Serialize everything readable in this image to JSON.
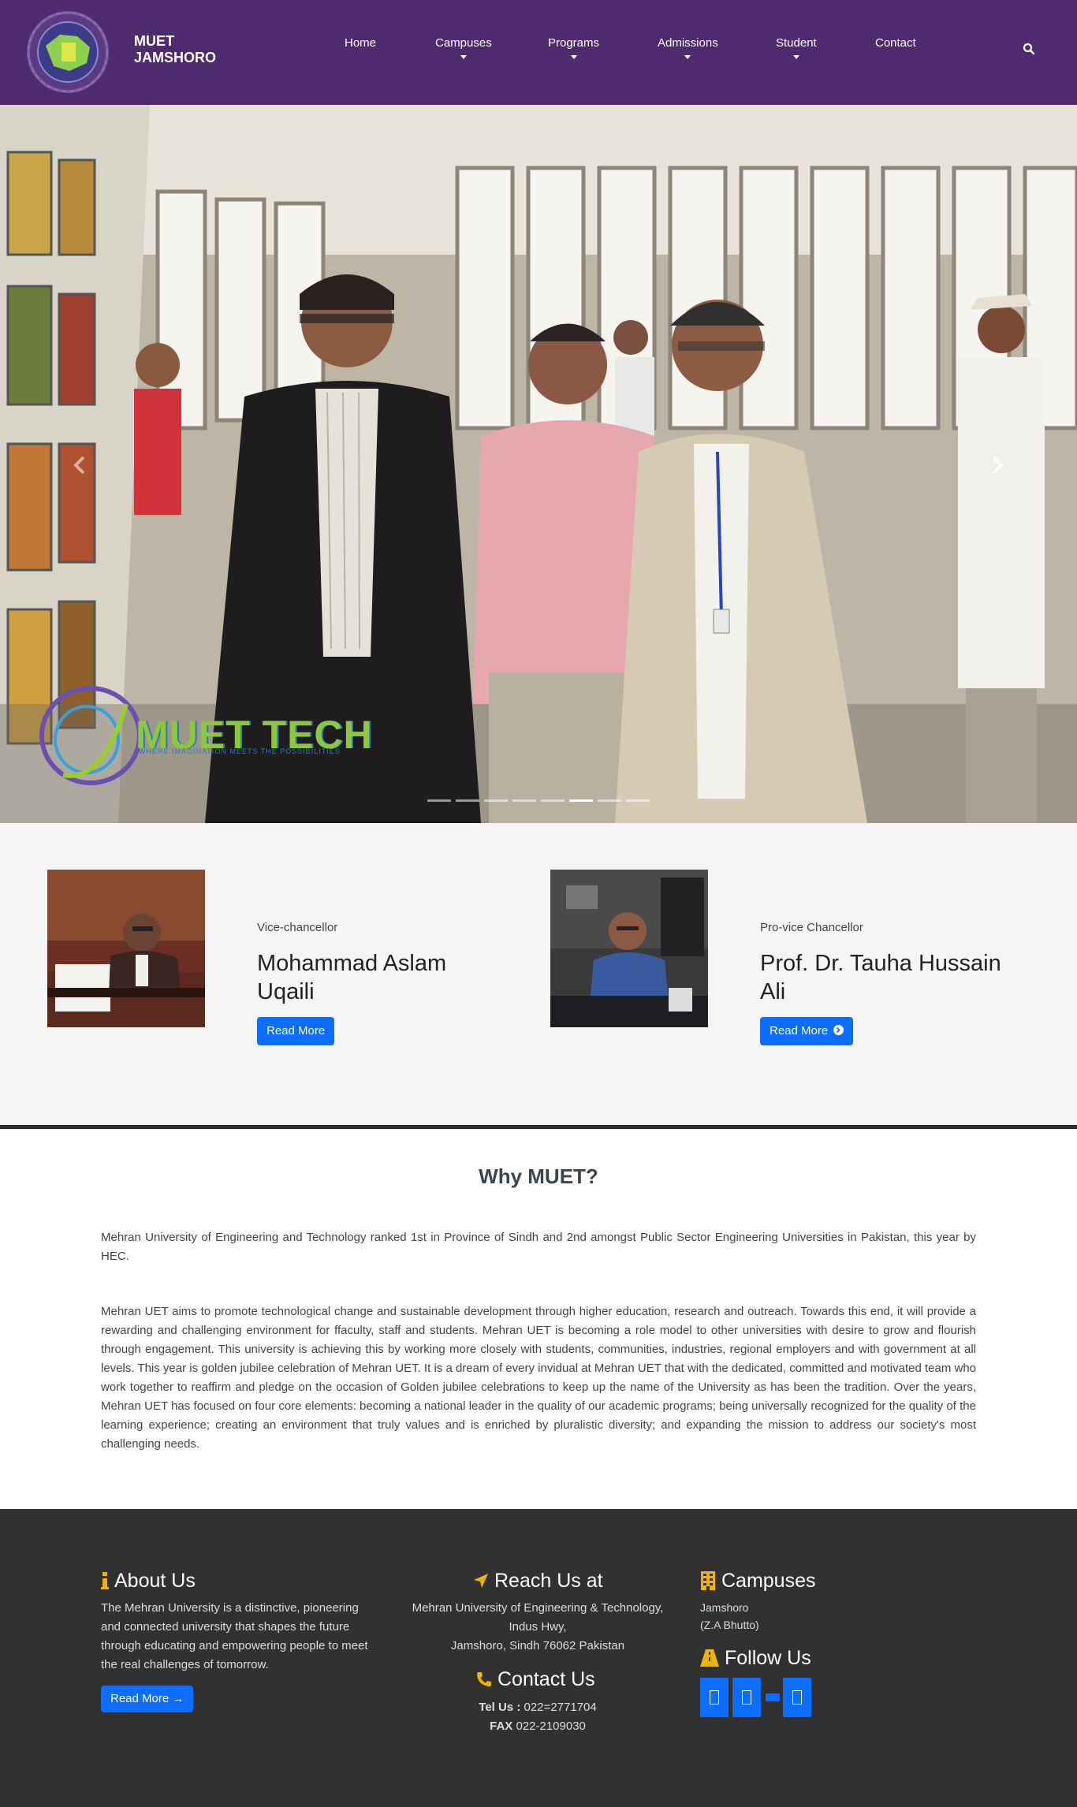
{
  "nav": {
    "brand": "MUET\nJAMSHORO",
    "items": [
      {
        "label": "Home",
        "dropdown": false
      },
      {
        "label": "Campuses",
        "dropdown": true
      },
      {
        "label": "Programs",
        "dropdown": true
      },
      {
        "label": "Admissions",
        "dropdown": true
      },
      {
        "label": "Student",
        "dropdown": true
      },
      {
        "label": "Contact",
        "dropdown": false
      }
    ],
    "search_icon": "search-icon"
  },
  "hero": {
    "overlay_logo_text": "MUET TECH",
    "overlay_tagline": "WHERE IMAGINATION MEETS THE POSSIBILITIES",
    "slide_count": 8,
    "active_slide": 6
  },
  "leaders": [
    {
      "role": "Vice-chancellor",
      "name": "Mohammad Aslam Uqaili",
      "button": "Read More"
    },
    {
      "role": "Pro-vice Chancellor",
      "name": "Prof. Dr. Tauha Hussain Ali",
      "button": "Read More"
    }
  ],
  "why": {
    "title": "Why MUET?",
    "p1": "Mehran University of Engineering and Technology ranked 1st in Province of Sindh and 2nd amongst Public Sector Engineering Universities in Pakistan, this year by HEC.",
    "p2": "Mehran UET aims to promote technological change and sustainable development through higher education, research and outreach. Towards this end, it will provide a rewarding and challenging environment for ffaculty, staff and students. Mehran UET is becoming a role model to other universities with desire to grow and flourish through engagement. This university is achieving this by working more closely with students, communities, industries, regional employers and with government at all levels. This year is golden jubilee celebration of Mehran UET. It is a dream of every invidual at Mehran UET that with the dedicated, committed and motivated team who work together to reaffirm and pledge on the occasion of Golden jubilee celebrations to keep up the name of the University as has been the tradition. Over the years, Mehran UET has focused on four core elements: becoming a national leader in the quality of our academic programs; being universally recognized for the quality of the learning experience; creating an environment that truly values and is enriched by pluralistic diversity; and expanding the mission to address our society's most challenging needs."
  },
  "footer": {
    "about": {
      "title": "About Us",
      "text": "The Mehran University is a distinctive, pioneering and connected university that shapes the future through educating and empowering people to meet the real challenges of tomorrow.",
      "button": "Read More →"
    },
    "reach": {
      "title": "Reach Us at",
      "line1": "Mehran University of Engineering & Technology,",
      "line2": "Indus Hwy,",
      "line3": "Jamshoro, Sindh 76062 Pakistan"
    },
    "contact": {
      "title": "Contact Us",
      "tel_label": "Tel Us :",
      "tel": "022=2771704",
      "fax_label": "FAX",
      "fax": "022-2109030"
    },
    "campuses": {
      "title": "Campuses",
      "line1": "Jamshoro",
      "line2": "(Z.A Bhutto)"
    },
    "follow": {
      "title": "Follow Us",
      "icons": [
        "facebook-icon",
        "twitter-icon",
        "youtube-icon",
        "linkedin-icon"
      ]
    }
  },
  "colors": {
    "navbar": "#4e2a6f",
    "button": "#0d6efd",
    "footer": "#313131",
    "icon_accent": "#f0b400"
  }
}
